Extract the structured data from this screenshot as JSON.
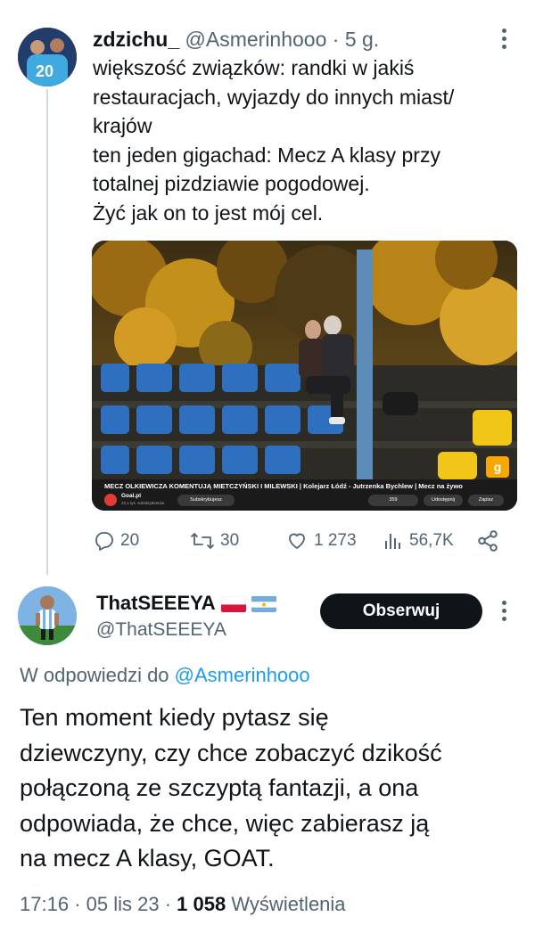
{
  "tweet1": {
    "display_name": "zdzichu_",
    "handle": "@Asmerinhooo",
    "time": "· 5 g.",
    "text_lines": [
      "większość związków: randki w jakiś",
      "restauracjach, wyjazdy do innych miast/",
      "krajów",
      "ten jeden gigachad: Mecz A klasy przy",
      "totalnej pizdziawie pogodowej.",
      "Żyć jak on to jest mój cel."
    ],
    "media": {
      "video_title": "MECZ OLKIEWICZA KOMENTUJĄ MIETCZYŃSKI I MILEWSKI | Kolejarz Łódź - Jutrzenka Bychlew | Mecz na żywo",
      "channel_name": "Goal.pl",
      "channel_subs": "22,1 tys. subskrybentów",
      "subscribe_label": "Subskrybujesz",
      "likes": "359",
      "share_label": "Udostępnij",
      "save_label": "Zapisz",
      "badge": "g"
    },
    "stats": {
      "replies": "20",
      "retweets": "30",
      "likes": "1 273",
      "views": "56,7K"
    }
  },
  "tweet2": {
    "display_name": "ThatSEEEYA",
    "handle": "@ThatSEEEYA",
    "follow_label": "Obserwuj",
    "reply_prefix": "W odpowiedzi do",
    "reply_to": "@Asmerinhooo",
    "text_lines": [
      "Ten moment kiedy pytasz się",
      "dziewczyny, czy chce zobaczyć dzikość",
      "połączoną ze szczyptą fantazji, a ona",
      "odpowiada, że chce, więc zabierasz ją",
      "na mecz A klasy, GOAT."
    ],
    "time": "17:16",
    "date": "05 lis 23",
    "views": "1 058",
    "views_label": "Wyświetlenia"
  },
  "colors": {
    "accent": "#1d9bf0",
    "muted": "#536471",
    "text": "#0f1419",
    "seat_blue": "#2f6fbf"
  }
}
